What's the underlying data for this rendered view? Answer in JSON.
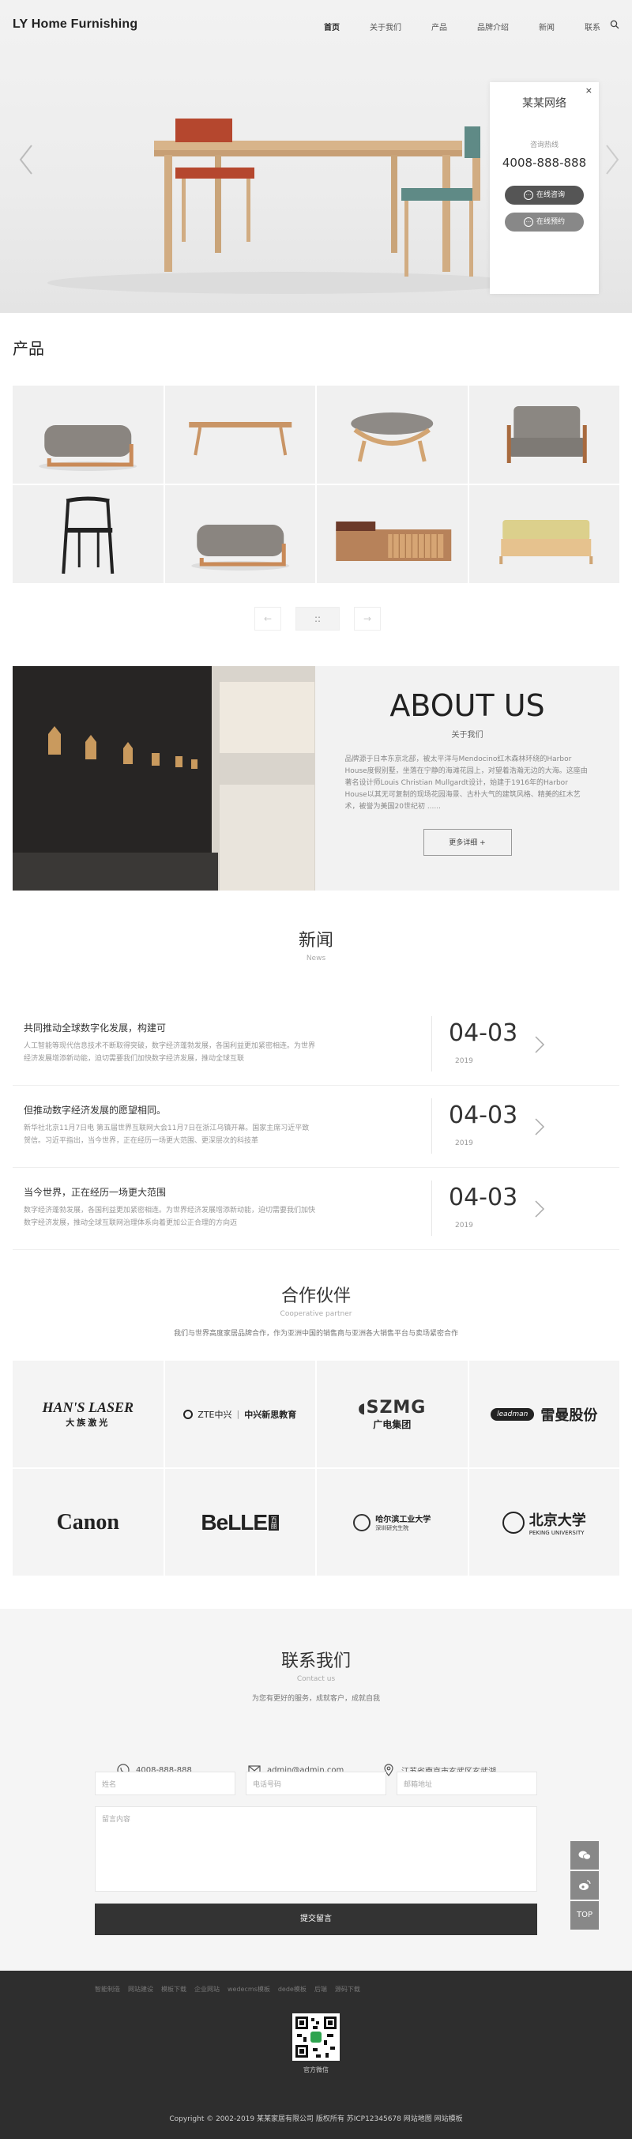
{
  "header": {
    "logo": "LY Home Furnishing",
    "nav": [
      "首页",
      "关于我们",
      "产品",
      "品牌介绍",
      "新闻",
      "联系"
    ]
  },
  "consult": {
    "close": "×",
    "company": "某某网络",
    "hotline_label": "咨询热线",
    "phone": "4008-888-888",
    "btn_online": "在线咨询",
    "btn_reserve": "在线预约"
  },
  "products": {
    "title": "产品",
    "items": [
      "ottoman-grey",
      "bench-table",
      "cushion-stool",
      "armchair-grey",
      "black-chair",
      "ottoman-grey-2",
      "sideboard-wood",
      "daybed-yellow"
    ],
    "pager": [
      "←",
      "::",
      "→"
    ]
  },
  "about": {
    "heading": "ABOUT US",
    "sub": "关于我们",
    "text": "品牌源于日本东京北部，被太平洋与Mendocino红木森林环绕的Harbor House度假别墅，坐落在宁静的海滩花园上，对望着浩瀚无边的大海。这座由著名设计师Louis Christian Mullgardt设计，始建于1916年的Harbor House以其无可复制的现场花园海景、古朴大气的建筑风格、精美的红木艺术，被誉为美国20世纪初 ......",
    "more": "更多详细 +"
  },
  "news": {
    "title": "新闻",
    "sub": "News",
    "items": [
      {
        "title": "共同推动全球数字化发展，构建可",
        "desc": "人工智能等现代信息技术不断取得突破，数字经济蓬勃发展，各国利益更加紧密相连。为世界经济发展增添新动能，迫切需要我们加快数字经济发展，推动全球互联",
        "date": "04-03",
        "year": "2019"
      },
      {
        "title": "但推动数字经济发展的愿望相同。",
        "desc": "新华社北京11月7日电 第五届世界互联网大会11月7日在浙江乌镇开幕。国家主席习近平致贺信。习近平指出，当今世界，正在经历一场更大范围、更深层次的科技革",
        "date": "04-03",
        "year": "2019"
      },
      {
        "title": "当今世界，正在经历一场更大范围",
        "desc": "数字经济蓬勃发展，各国利益更加紧密相连。为世界经济发展增添新动能，迫切需要我们加快数字经济发展，推动全球互联网治理体系向着更加公正合理的方向迈",
        "date": "04-03",
        "year": "2019"
      }
    ]
  },
  "partners": {
    "title": "合作伙伴",
    "sub": "Cooperative partner",
    "desc": "我们与世界高度家居品牌合作，作为亚洲中国的销售商与亚洲各大销售平台与卖场紧密合作",
    "logos": [
      {
        "name": "hans-laser",
        "l1": "HAN'S LASER",
        "l2": "大族激光"
      },
      {
        "name": "zte",
        "l1": "ZTE中兴",
        "l2": "中兴新思教育"
      },
      {
        "name": "szmg",
        "l1": "SZMG",
        "l2": "广电集团"
      },
      {
        "name": "leadman",
        "l1": "leadman",
        "l2": "雷曼股份"
      },
      {
        "name": "canon",
        "l1": "Canon",
        "l2": ""
      },
      {
        "name": "belle",
        "l1": "BeLLE",
        "l2": "百丽"
      },
      {
        "name": "hit",
        "l1": "哈尔滨工业大学",
        "l2": "深圳研究生院"
      },
      {
        "name": "pku",
        "l1": "北京大学",
        "l2": "PEKING UNIVERSITY"
      }
    ]
  },
  "contact": {
    "title": "联系我们",
    "sub": "Contact us",
    "desc": "为您有更好的服务，成就客户，成就自我",
    "phone": "4008-888-888",
    "email": "admin@admin.com",
    "address": "江苏省南京市玄武区玄武湖",
    "ph_name": "姓名",
    "ph_phone": "电话号码",
    "ph_email": "邮箱地址",
    "ph_message": "留言内容",
    "submit": "提交留言"
  },
  "footer": {
    "links": [
      "智能制造",
      "网站建设",
      "模板下载",
      "企业网站",
      "wedecms模板",
      "dede模板",
      "后端",
      "源码下载"
    ],
    "qr_label": "官方微信",
    "copyright": "Copyright © 2002-2019 某某家居有限公司 版权所有   苏ICP12345678   网站地图   网站模板"
  },
  "side": {
    "wechat": "wechat",
    "weibo": "weibo",
    "top": "TOP"
  },
  "colors": {
    "dark": "#333333",
    "accent_grey": "#555555",
    "bg_light": "#f5f5f5"
  }
}
